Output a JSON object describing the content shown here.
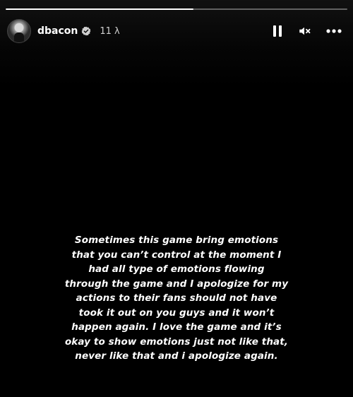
{
  "story": {
    "progress": 0.55,
    "username": "dbacon",
    "timestamp": "11 λ",
    "verified": true,
    "icons": {
      "pause": "pause-icon",
      "mute": "mute-icon",
      "more": "more-options-icon",
      "verified": "verified-badge-icon"
    },
    "caption_lines": [
      "Sometimes this game bring emotions",
      "that you can’t control at the moment I",
      "had all type of emotions flowing",
      "through the game and I apologize for my",
      "actions to their fans should not have",
      "took it out on you guys and it won’t",
      "happen again. I love the game and it’s",
      "okay to show emotions just not like that,",
      "never like that and i apologize again."
    ]
  },
  "colors": {
    "background": "#000000",
    "text": "#ffffff",
    "progress_track": "#5a5a5a",
    "progress_fill": "#ffffff"
  }
}
